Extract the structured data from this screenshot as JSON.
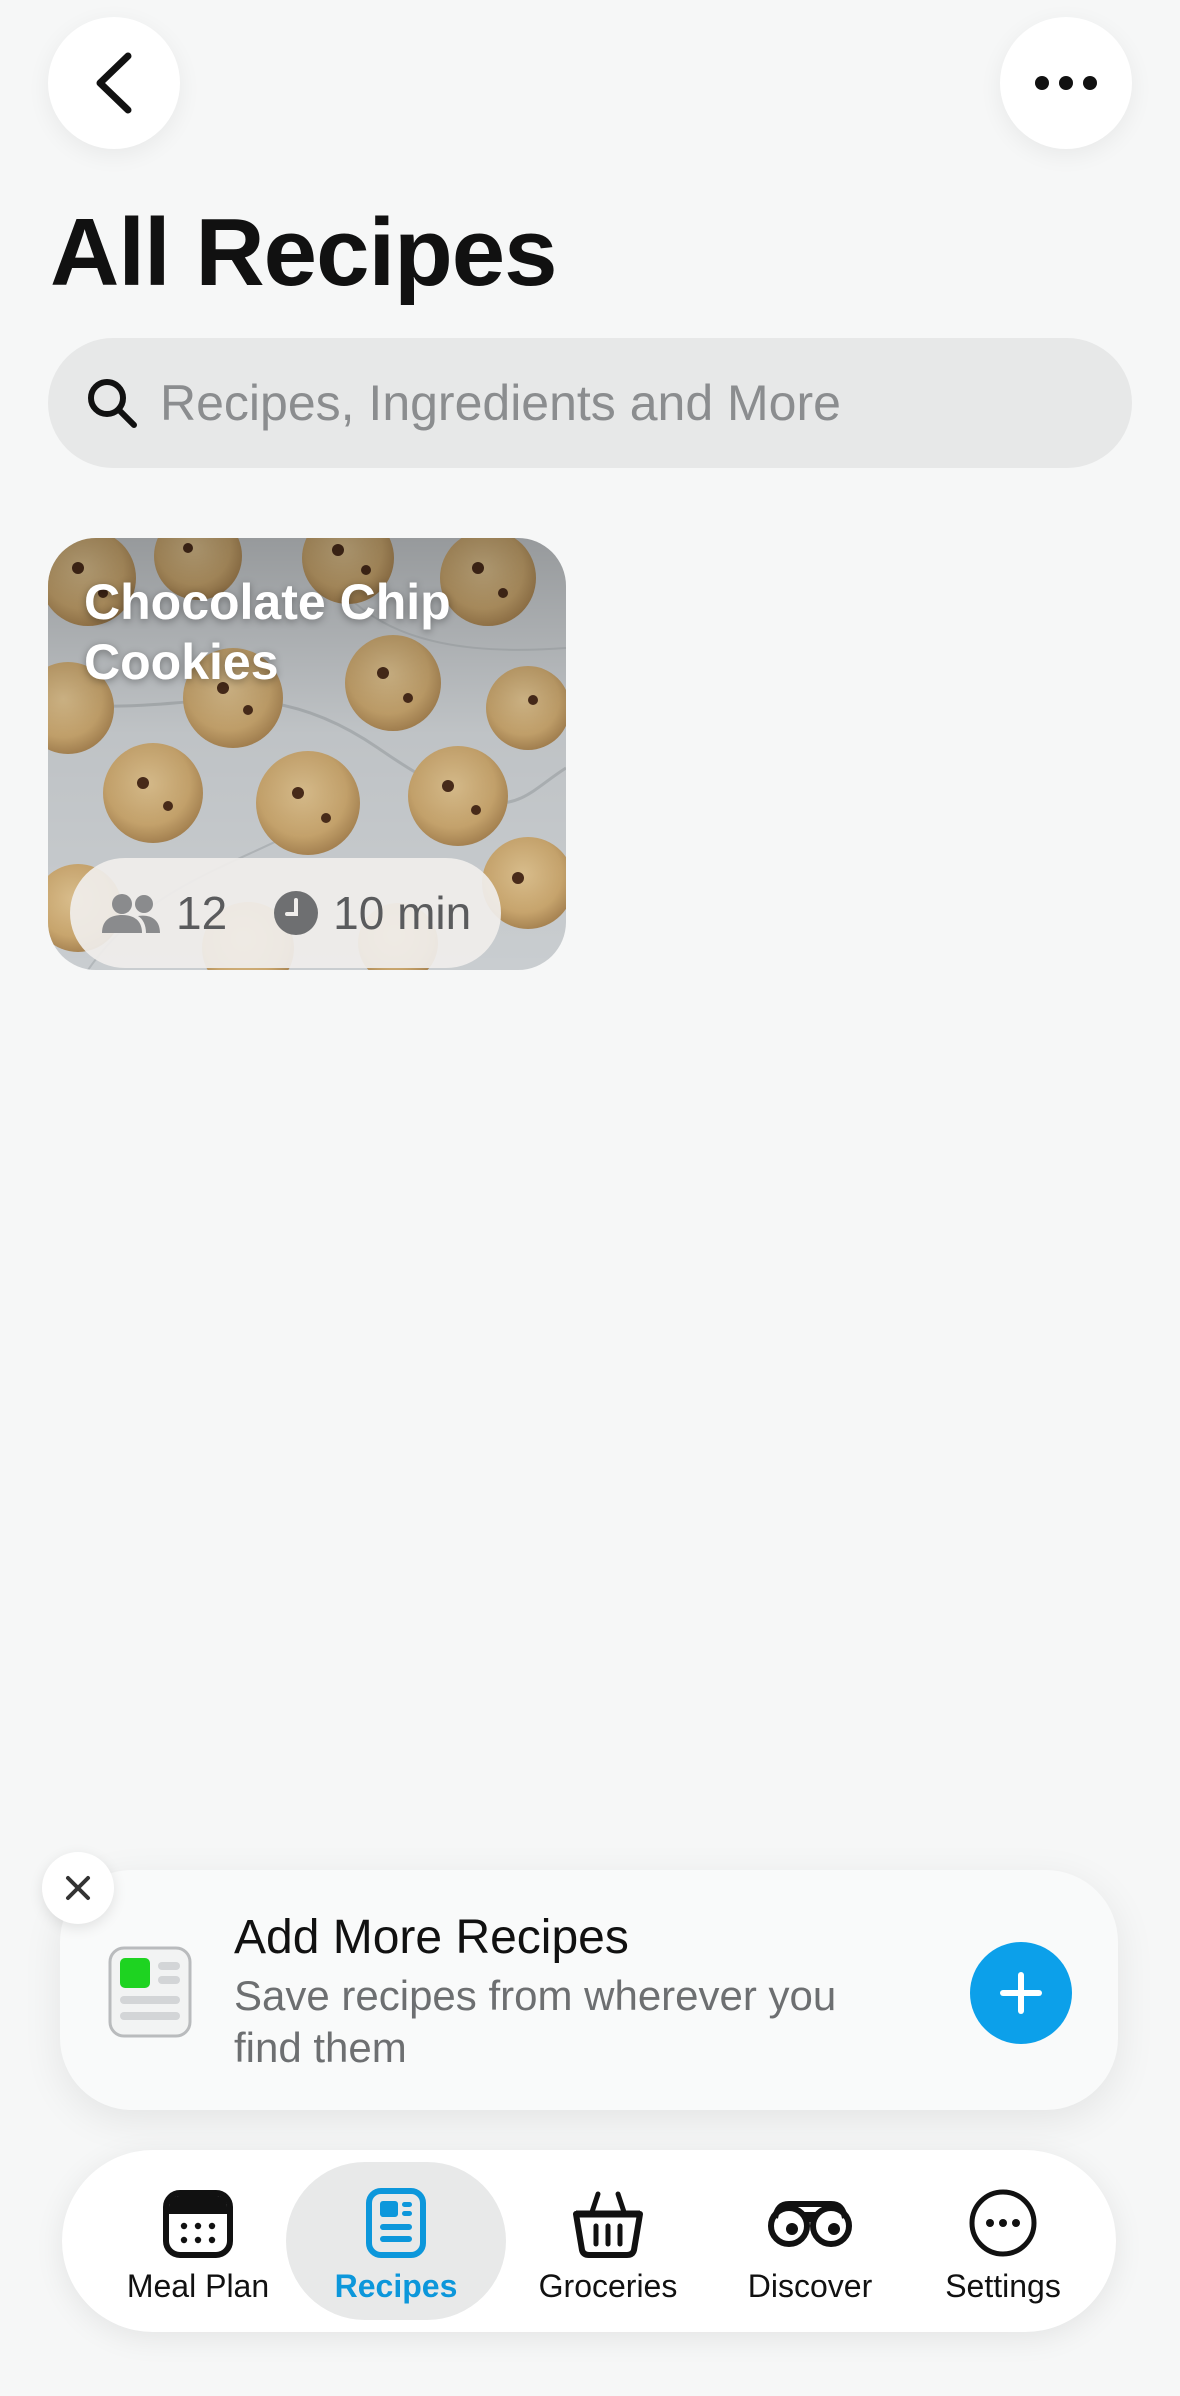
{
  "header": {
    "back_icon": "chevron-left-icon",
    "more_icon": "ellipsis-icon",
    "title": "All Recipes"
  },
  "search": {
    "placeholder": "Recipes, Ingredients and More",
    "value": ""
  },
  "recipes": [
    {
      "title": "Chocolate Chip Cookies",
      "servings": "12",
      "time": "10 min"
    }
  ],
  "promo": {
    "title": "Add More Recipes",
    "text": "Save recipes from wherever you find them",
    "accent_color": "#0ca0ea"
  },
  "tabs": [
    {
      "label": "Meal Plan",
      "icon": "calendar-icon",
      "active": false
    },
    {
      "label": "Recipes",
      "icon": "recipe-book-icon",
      "active": true
    },
    {
      "label": "Groceries",
      "icon": "basket-icon",
      "active": false
    },
    {
      "label": "Discover",
      "icon": "binoculars-icon",
      "active": false
    },
    {
      "label": "Settings",
      "icon": "ellipsis-circle-icon",
      "active": false
    }
  ],
  "colors": {
    "background": "#f6f7f7",
    "active_tab": "#0c97db"
  }
}
